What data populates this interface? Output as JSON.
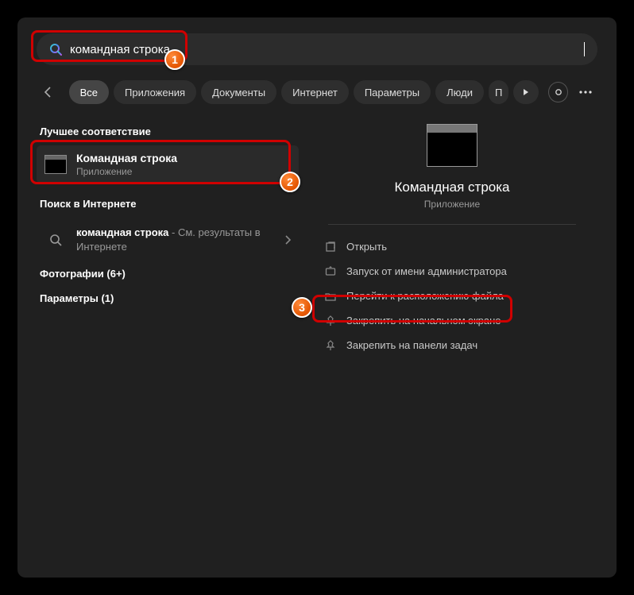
{
  "search": {
    "value": "командная строка",
    "placeholder": ""
  },
  "filters": {
    "items": [
      {
        "label": "Все",
        "active": true
      },
      {
        "label": "Приложения",
        "active": false
      },
      {
        "label": "Документы",
        "active": false
      },
      {
        "label": "Интернет",
        "active": false
      },
      {
        "label": "Параметры",
        "active": false
      },
      {
        "label": "Люди",
        "active": false
      }
    ],
    "truncated": "П"
  },
  "left": {
    "best_match_heading": "Лучшее соответствие",
    "best": {
      "title": "Командная строка",
      "subtitle": "Приложение"
    },
    "web_heading": "Поиск в Интернете",
    "web": {
      "highlight": "командная строка",
      "tail": " - См. результаты в Интернете"
    },
    "categories": [
      "Фотографии (6+)",
      "Параметры (1)"
    ]
  },
  "preview": {
    "title": "Командная строка",
    "subtitle": "Приложение",
    "actions": [
      {
        "icon": "open",
        "label": "Открыть"
      },
      {
        "icon": "admin",
        "label": "Запуск от имени администратора"
      },
      {
        "icon": "folder",
        "label": "Перейти к расположению файла"
      },
      {
        "icon": "pin",
        "label": "Закрепить на начальном экране"
      },
      {
        "icon": "pin",
        "label": "Закрепить на панели задач"
      }
    ]
  },
  "annotations": {
    "b1": "1",
    "b2": "2",
    "b3": "3"
  }
}
